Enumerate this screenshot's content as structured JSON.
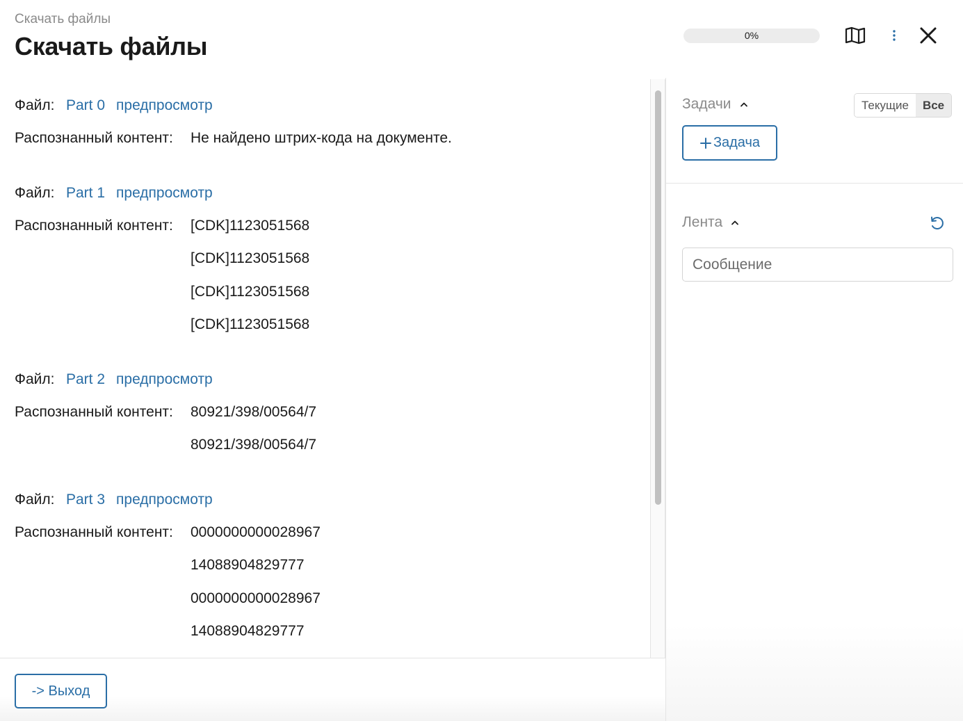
{
  "header": {
    "breadcrumb": "Скачать файлы",
    "title": "Скачать файлы",
    "progress_text": "0%",
    "progress_value": 0,
    "icons": [
      "map-icon",
      "more-vertical-icon",
      "close-icon"
    ]
  },
  "files": [
    {
      "file_label": "Файл:",
      "part_name": "Part 0",
      "preview_label": "предпросмотр",
      "content_label": "Распознанный контент:",
      "values": [
        "Не найдено штрих-кода на документе."
      ]
    },
    {
      "file_label": "Файл:",
      "part_name": "Part 1",
      "preview_label": "предпросмотр",
      "content_label": "Распознанный контент:",
      "values": [
        "[CDK]1123051568",
        "[CDK]1123051568",
        "[CDK]1123051568",
        "[CDK]1123051568"
      ]
    },
    {
      "file_label": "Файл:",
      "part_name": "Part 2",
      "preview_label": "предпросмотр",
      "content_label": "Распознанный контент:",
      "values": [
        "80921/398/00564/7",
        "80921/398/00564/7"
      ]
    },
    {
      "file_label": "Файл:",
      "part_name": "Part 3",
      "preview_label": "предпросмотр",
      "content_label": "Распознанный контент:",
      "values": [
        "0000000000028967",
        "14088904829777",
        "0000000000028967",
        "14088904829777"
      ]
    }
  ],
  "footer": {
    "exit_label": "-> Выход"
  },
  "right_panel": {
    "tasks_title": "Задачи",
    "filter_current": "Текущие",
    "filter_all": "Все",
    "filter_selected": "Все",
    "add_task_label": "Задача",
    "feed_title": "Лента",
    "message_placeholder": "Сообщение"
  },
  "colors": {
    "accent": "#2a6ea6",
    "muted_text": "#8a8a8a"
  }
}
